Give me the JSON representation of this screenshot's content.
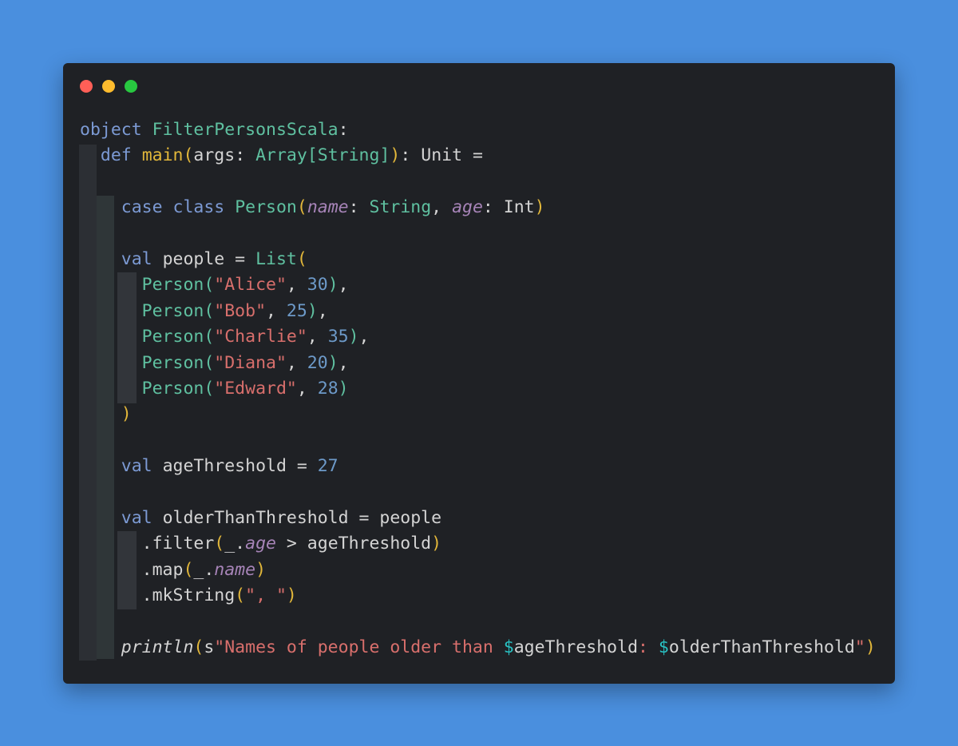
{
  "window": {
    "controls": [
      {
        "name": "close-button",
        "color": "#ff5f57"
      },
      {
        "name": "minimize-button",
        "color": "#febc2e"
      },
      {
        "name": "zoom-button",
        "color": "#28c840"
      }
    ]
  },
  "theme": {
    "page_background": "#4a8fde",
    "editor_background": "#1f2125",
    "keyword": "#7c9ad4",
    "type": "#5fc0a0",
    "string": "#d86f6c",
    "number": "#6d9ac9",
    "paren": "#e2b73a",
    "param": "#a784b8",
    "plain": "#d4d4d4",
    "interp": "#29c2c4"
  },
  "code": {
    "lines": [
      {
        "indent": 0,
        "tokens": [
          {
            "t": "object",
            "c": "keyword"
          },
          {
            "t": " "
          },
          {
            "t": "FilterPersonsScala",
            "c": "type"
          },
          {
            "t": ":"
          }
        ]
      },
      {
        "indent": 1,
        "tokens": [
          {
            "t": "def",
            "c": "keyword"
          },
          {
            "t": " "
          },
          {
            "t": "main",
            "c": "func"
          },
          {
            "t": "(",
            "c": "paren"
          },
          {
            "t": "args"
          },
          {
            "t": ": "
          },
          {
            "t": "Array",
            "c": "type"
          },
          {
            "t": "[",
            "c": "paren2"
          },
          {
            "t": "String",
            "c": "type"
          },
          {
            "t": "]",
            "c": "paren2"
          },
          {
            "t": ")",
            "c": "paren"
          },
          {
            "t": ": Unit ="
          }
        ]
      },
      {
        "indent": 0,
        "tokens": []
      },
      {
        "indent": 2,
        "tokens": [
          {
            "t": "case",
            "c": "keyword"
          },
          {
            "t": " "
          },
          {
            "t": "class",
            "c": "keyword"
          },
          {
            "t": " "
          },
          {
            "t": "Person",
            "c": "type"
          },
          {
            "t": "(",
            "c": "paren"
          },
          {
            "t": "name",
            "c": "param"
          },
          {
            "t": ": "
          },
          {
            "t": "String",
            "c": "type"
          },
          {
            "t": ", "
          },
          {
            "t": "age",
            "c": "param"
          },
          {
            "t": ": Int"
          },
          {
            "t": ")",
            "c": "paren"
          }
        ]
      },
      {
        "indent": 0,
        "tokens": []
      },
      {
        "indent": 2,
        "tokens": [
          {
            "t": "val",
            "c": "keyword"
          },
          {
            "t": " people = "
          },
          {
            "t": "List",
            "c": "type"
          },
          {
            "t": "(",
            "c": "paren"
          }
        ]
      },
      {
        "indent": 3,
        "tokens": [
          {
            "t": "Person",
            "c": "type"
          },
          {
            "t": "(",
            "c": "paren2"
          },
          {
            "t": "\"Alice\"",
            "c": "string"
          },
          {
            "t": ", "
          },
          {
            "t": "30",
            "c": "number"
          },
          {
            "t": ")",
            "c": "paren2"
          },
          {
            "t": ","
          }
        ]
      },
      {
        "indent": 3,
        "tokens": [
          {
            "t": "Person",
            "c": "type"
          },
          {
            "t": "(",
            "c": "paren2"
          },
          {
            "t": "\"Bob\"",
            "c": "string"
          },
          {
            "t": ", "
          },
          {
            "t": "25",
            "c": "number"
          },
          {
            "t": ")",
            "c": "paren2"
          },
          {
            "t": ","
          }
        ]
      },
      {
        "indent": 3,
        "tokens": [
          {
            "t": "Person",
            "c": "type"
          },
          {
            "t": "(",
            "c": "paren2"
          },
          {
            "t": "\"Charlie\"",
            "c": "string"
          },
          {
            "t": ", "
          },
          {
            "t": "35",
            "c": "number"
          },
          {
            "t": ")",
            "c": "paren2"
          },
          {
            "t": ","
          }
        ]
      },
      {
        "indent": 3,
        "tokens": [
          {
            "t": "Person",
            "c": "type"
          },
          {
            "t": "(",
            "c": "paren2"
          },
          {
            "t": "\"Diana\"",
            "c": "string"
          },
          {
            "t": ", "
          },
          {
            "t": "20",
            "c": "number"
          },
          {
            "t": ")",
            "c": "paren2"
          },
          {
            "t": ","
          }
        ]
      },
      {
        "indent": 3,
        "tokens": [
          {
            "t": "Person",
            "c": "type"
          },
          {
            "t": "(",
            "c": "paren2"
          },
          {
            "t": "\"Edward\"",
            "c": "string"
          },
          {
            "t": ", "
          },
          {
            "t": "28",
            "c": "number"
          },
          {
            "t": ")",
            "c": "paren2"
          }
        ]
      },
      {
        "indent": 2,
        "tokens": [
          {
            "t": ")",
            "c": "paren"
          }
        ]
      },
      {
        "indent": 0,
        "tokens": []
      },
      {
        "indent": 2,
        "tokens": [
          {
            "t": "val",
            "c": "keyword"
          },
          {
            "t": " ageThreshold = "
          },
          {
            "t": "27",
            "c": "number"
          }
        ]
      },
      {
        "indent": 0,
        "tokens": []
      },
      {
        "indent": 2,
        "tokens": [
          {
            "t": "val",
            "c": "keyword"
          },
          {
            "t": " olderThanThreshold = people"
          }
        ]
      },
      {
        "indent": 3,
        "tokens": [
          {
            "t": ".filter"
          },
          {
            "t": "(",
            "c": "paren"
          },
          {
            "t": "_."
          },
          {
            "t": "age",
            "c": "param"
          },
          {
            "t": " > ageThreshold"
          },
          {
            "t": ")",
            "c": "paren"
          }
        ]
      },
      {
        "indent": 3,
        "tokens": [
          {
            "t": ".map"
          },
          {
            "t": "(",
            "c": "paren"
          },
          {
            "t": "_."
          },
          {
            "t": "name",
            "c": "param"
          },
          {
            "t": ")",
            "c": "paren"
          }
        ]
      },
      {
        "indent": 3,
        "tokens": [
          {
            "t": ".mkString"
          },
          {
            "t": "(",
            "c": "paren"
          },
          {
            "t": "\", \"",
            "c": "string"
          },
          {
            "t": ")",
            "c": "paren"
          }
        ]
      },
      {
        "indent": 0,
        "tokens": []
      },
      {
        "indent": 2,
        "tokens": [
          {
            "t": "println",
            "c": "callitalic"
          },
          {
            "t": "(",
            "c": "paren"
          },
          {
            "t": "s"
          },
          {
            "t": "\"Names of people older than ",
            "c": "string"
          },
          {
            "t": "$",
            "c": "interp"
          },
          {
            "t": "ageThreshold"
          },
          {
            "t": ": ",
            "c": "string"
          },
          {
            "t": "$",
            "c": "interp"
          },
          {
            "t": "olderThanThreshold"
          },
          {
            "t": "\"",
            "c": "string"
          },
          {
            "t": ")",
            "c": "paren"
          }
        ]
      }
    ]
  }
}
